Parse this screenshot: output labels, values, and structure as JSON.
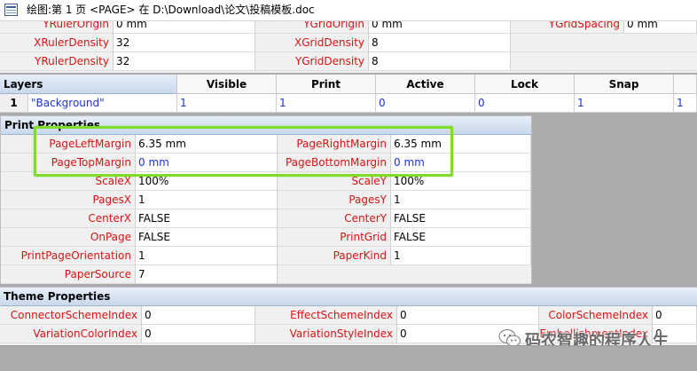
{
  "window": {
    "title": "绘图:第 1 页 <PAGE> 在 D:\\Download\\论文\\投稿模板.doc"
  },
  "ruler_grid": {
    "rows": [
      {
        "l1": "YRulerOrigin",
        "v1": "0 mm",
        "l2": "YGridOrigin",
        "v2": "0 mm",
        "l3": "YGridSpacing",
        "v3": "0 mm"
      },
      {
        "l1": "XRulerDensity",
        "v1": "32",
        "l2": "XGridDensity",
        "v2": "8"
      },
      {
        "l1": "YRulerDensity",
        "v1": "32",
        "l2": "YGridDensity",
        "v2": "8"
      }
    ]
  },
  "layers": {
    "title": "Layers",
    "headers": [
      "Visible",
      "Print",
      "Active",
      "Lock",
      "Snap"
    ],
    "row": {
      "index": "1",
      "name": "\"Background\"",
      "values": [
        "1",
        "1",
        "0",
        "0",
        "1",
        "1"
      ]
    }
  },
  "print_properties": {
    "title": "Print Properties",
    "rows": [
      {
        "l1": "PageLeftMargin",
        "v1": "6.35 mm",
        "l2": "PageRightMargin",
        "v2": "6.35 mm",
        "blue": false
      },
      {
        "l1": "PageTopMargin",
        "v1": "0 mm",
        "l2": "PageBottomMargin",
        "v2": "0 mm",
        "blue": true
      },
      {
        "l1": "ScaleX",
        "v1": "100%",
        "l2": "ScaleY",
        "v2": "100%",
        "blue": false
      },
      {
        "l1": "PagesX",
        "v1": "1",
        "l2": "PagesY",
        "v2": "1",
        "blue": false
      },
      {
        "l1": "CenterX",
        "v1": "FALSE",
        "l2": "CenterY",
        "v2": "FALSE",
        "blue": false
      },
      {
        "l1": "OnPage",
        "v1": "FALSE",
        "l2": "PrintGrid",
        "v2": "FALSE",
        "blue": false
      },
      {
        "l1": "PrintPageOrientation",
        "v1": "1",
        "l2": "PaperKind",
        "v2": "1",
        "blue": false
      },
      {
        "l1": "PaperSource",
        "v1": "7"
      }
    ]
  },
  "theme_properties": {
    "title": "Theme Properties",
    "rows": [
      {
        "l1": "ConnectorSchemeIndex",
        "v1": "0",
        "l2": "EffectSchemeIndex",
        "v2": "0",
        "l3": "ColorSchemeIndex",
        "v3": "0"
      },
      {
        "l1": "VariationColorIndex",
        "v1": "0",
        "l2": "VariationStyleIndex",
        "v2": "0",
        "l3": "EmbellishmentIndex",
        "v3": "0"
      }
    ]
  },
  "watermark": {
    "text": "码农智趣的程序人生"
  },
  "colors": {
    "label_red": "#d81414",
    "value_blue": "#1a34d8",
    "highlight_green": "#7fdc2a"
  }
}
